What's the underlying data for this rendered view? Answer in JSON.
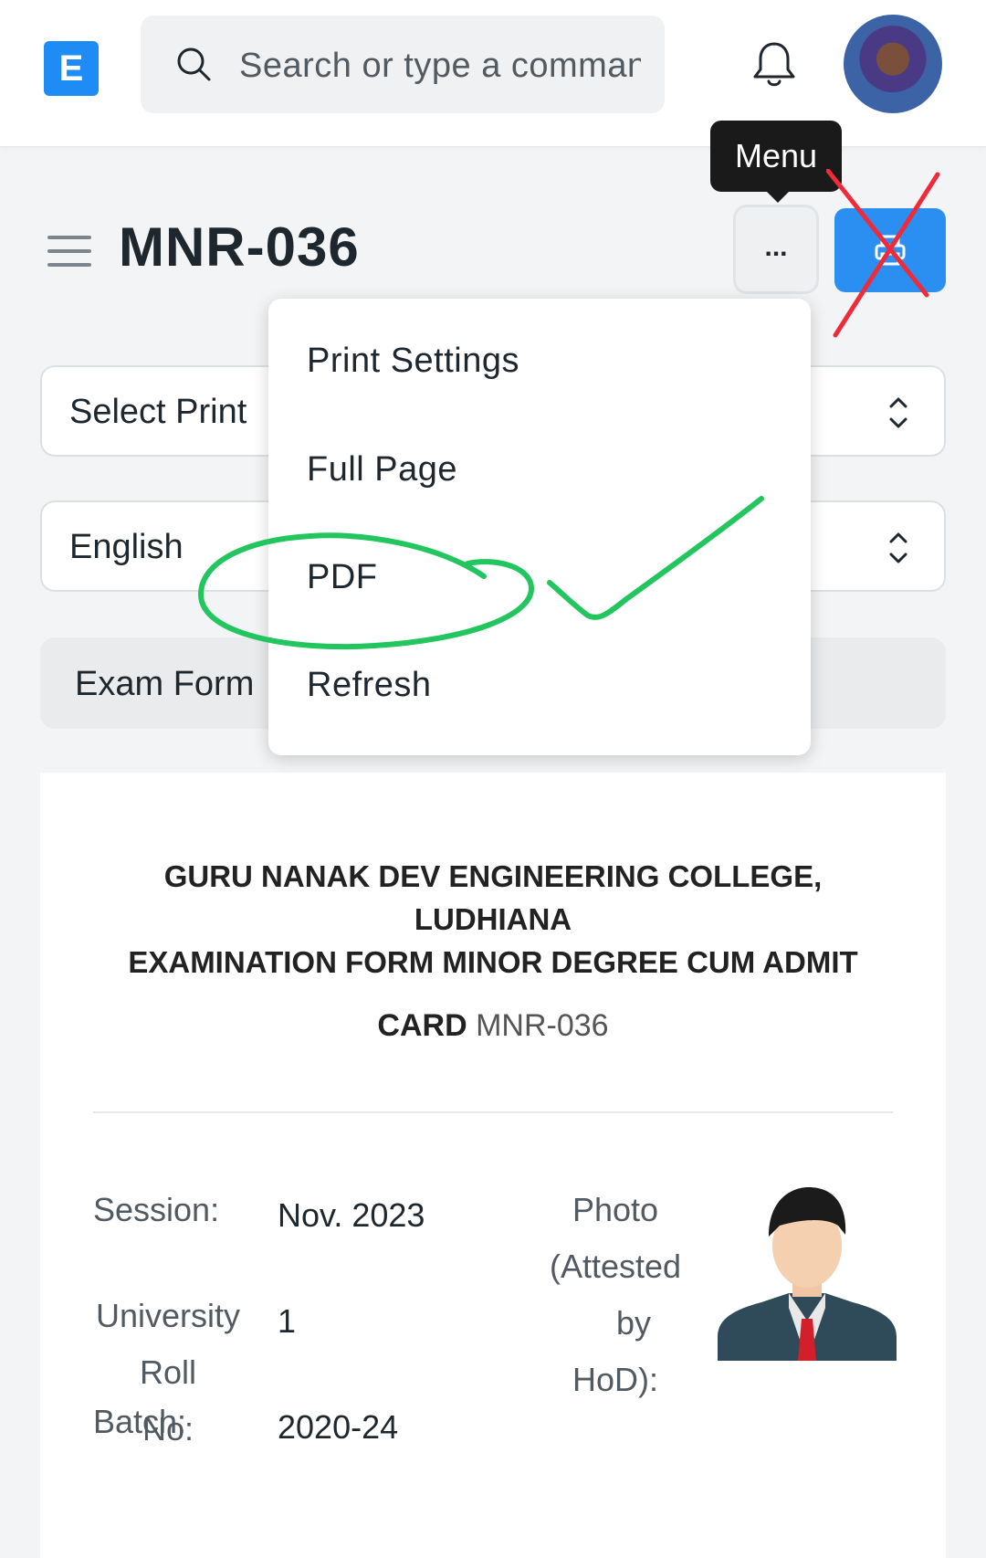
{
  "topbar": {
    "logo_letter": "E",
    "search_placeholder": "Search or type a command"
  },
  "header": {
    "title": "MNR-036",
    "tooltip": "Menu",
    "more_label": "..."
  },
  "filters": {
    "print_format": "Select Print",
    "language": "English",
    "exam_form": "Exam Form"
  },
  "menu": {
    "items": [
      "Print Settings",
      "Full Page",
      "PDF",
      "Refresh"
    ]
  },
  "document": {
    "title_line1": "GURU NANAK DEV ENGINEERING COLLEGE,",
    "title_line2": "LUDHIANA",
    "title_line3": "EXAMINATION FORM MINOR DEGREE CUM ADMIT",
    "card_word": "CARD",
    "card_id": "MNR-036",
    "session_label": "Session:",
    "session_value": "Nov. 2023",
    "roll_label_1": "University",
    "roll_label_2": "Roll",
    "roll_label_3": "No:",
    "roll_value": "1",
    "batch_label": "Batch:",
    "batch_value": "2020-24",
    "photo_label_1": "Photo",
    "photo_label_2": "(Attested",
    "photo_label_3": "by",
    "photo_label_4": "HoD):"
  },
  "colors": {
    "accent": "#2b8ff2",
    "annotation_green": "#22c55e",
    "annotation_red": "#ef2b3a"
  }
}
